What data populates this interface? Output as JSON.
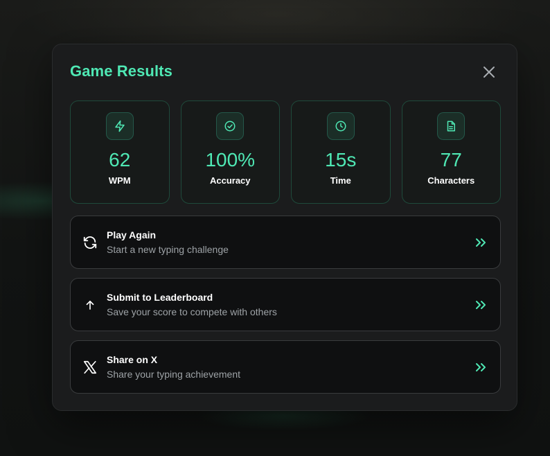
{
  "modal": {
    "title": "Game Results",
    "close_icon": "close-icon"
  },
  "stats": [
    {
      "icon": "lightning-icon",
      "value": "62",
      "label": "WPM"
    },
    {
      "icon": "check-circle-icon",
      "value": "100%",
      "label": "Accuracy"
    },
    {
      "icon": "clock-icon",
      "value": "15s",
      "label": "Time"
    },
    {
      "icon": "document-icon",
      "value": "77",
      "label": "Characters"
    }
  ],
  "actions": [
    {
      "icon": "refresh-icon",
      "title": "Play Again",
      "subtitle": "Start a new typing challenge"
    },
    {
      "icon": "arrow-up-icon",
      "title": "Submit to Leaderboard",
      "subtitle": "Save your score to compete with others"
    },
    {
      "icon": "x-logo-icon",
      "title": "Share on X",
      "subtitle": "Share your typing achievement"
    }
  ],
  "colors": {
    "accent": "#4fe8b4",
    "modal_bg": "#1b1c1d",
    "card_border": "#1f4a3b",
    "action_bg": "#0f1011"
  }
}
